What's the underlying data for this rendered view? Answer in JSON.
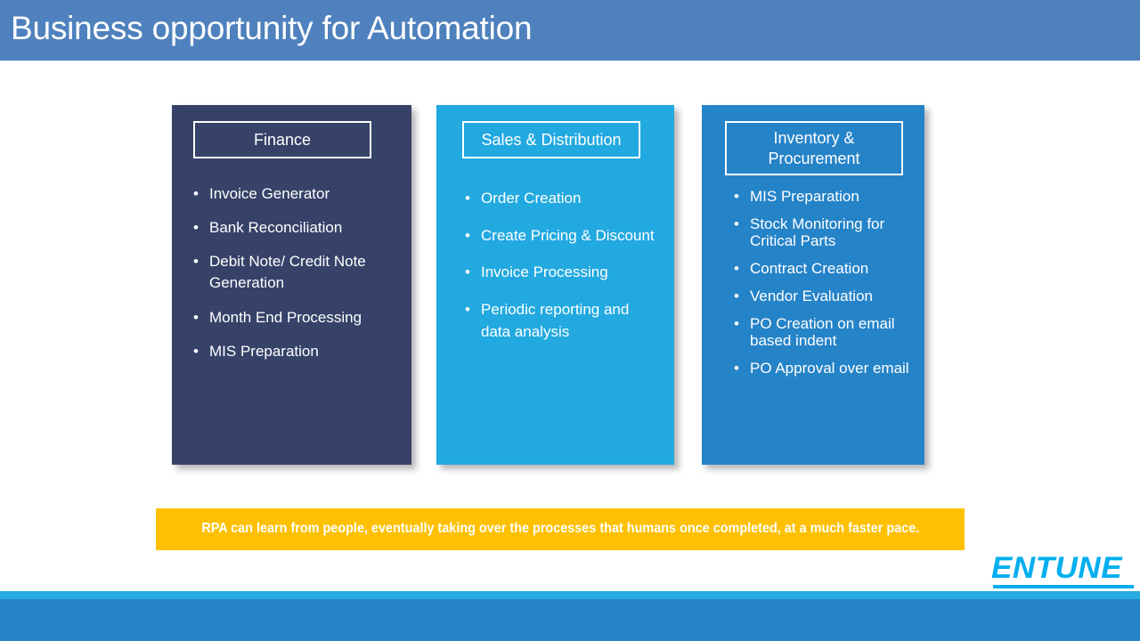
{
  "slide": {
    "title": "Business opportunity for Automation",
    "title_bar_color": "#4e81bd"
  },
  "cards": [
    {
      "id": "finance",
      "title": "Finance",
      "background_color": "#364268",
      "items": [
        "Invoice Generator",
        "Bank Reconciliation",
        "Debit Note/ Credit Note Generation",
        "Month End Processing",
        "MIS Preparation"
      ]
    },
    {
      "id": "sales",
      "title": "Sales & Distribution",
      "background_color": "#22a9e0",
      "items": [
        "Order Creation",
        "Create Pricing & Discount",
        "Invoice Processing",
        "Periodic reporting and data analysis"
      ]
    },
    {
      "id": "inventory",
      "title": "Inventory & Procurement",
      "background_color": "#2583c8",
      "items": [
        "MIS Preparation",
        "Stock Monitoring for Critical Parts",
        "Contract Creation",
        "Vendor Evaluation",
        "PO Creation on email based indent",
        "PO Approval over email"
      ]
    }
  ],
  "callout": {
    "text": "RPA can learn from people, eventually taking over the processes that humans once completed, at a much faster pace.",
    "background_color": "#fec000",
    "text_color": "#ffffff"
  },
  "logo": {
    "text": "ENTUNE",
    "color": "#00aeef"
  },
  "footer": {
    "strip_color": "#29abe2",
    "band_color": "#2585c8"
  }
}
